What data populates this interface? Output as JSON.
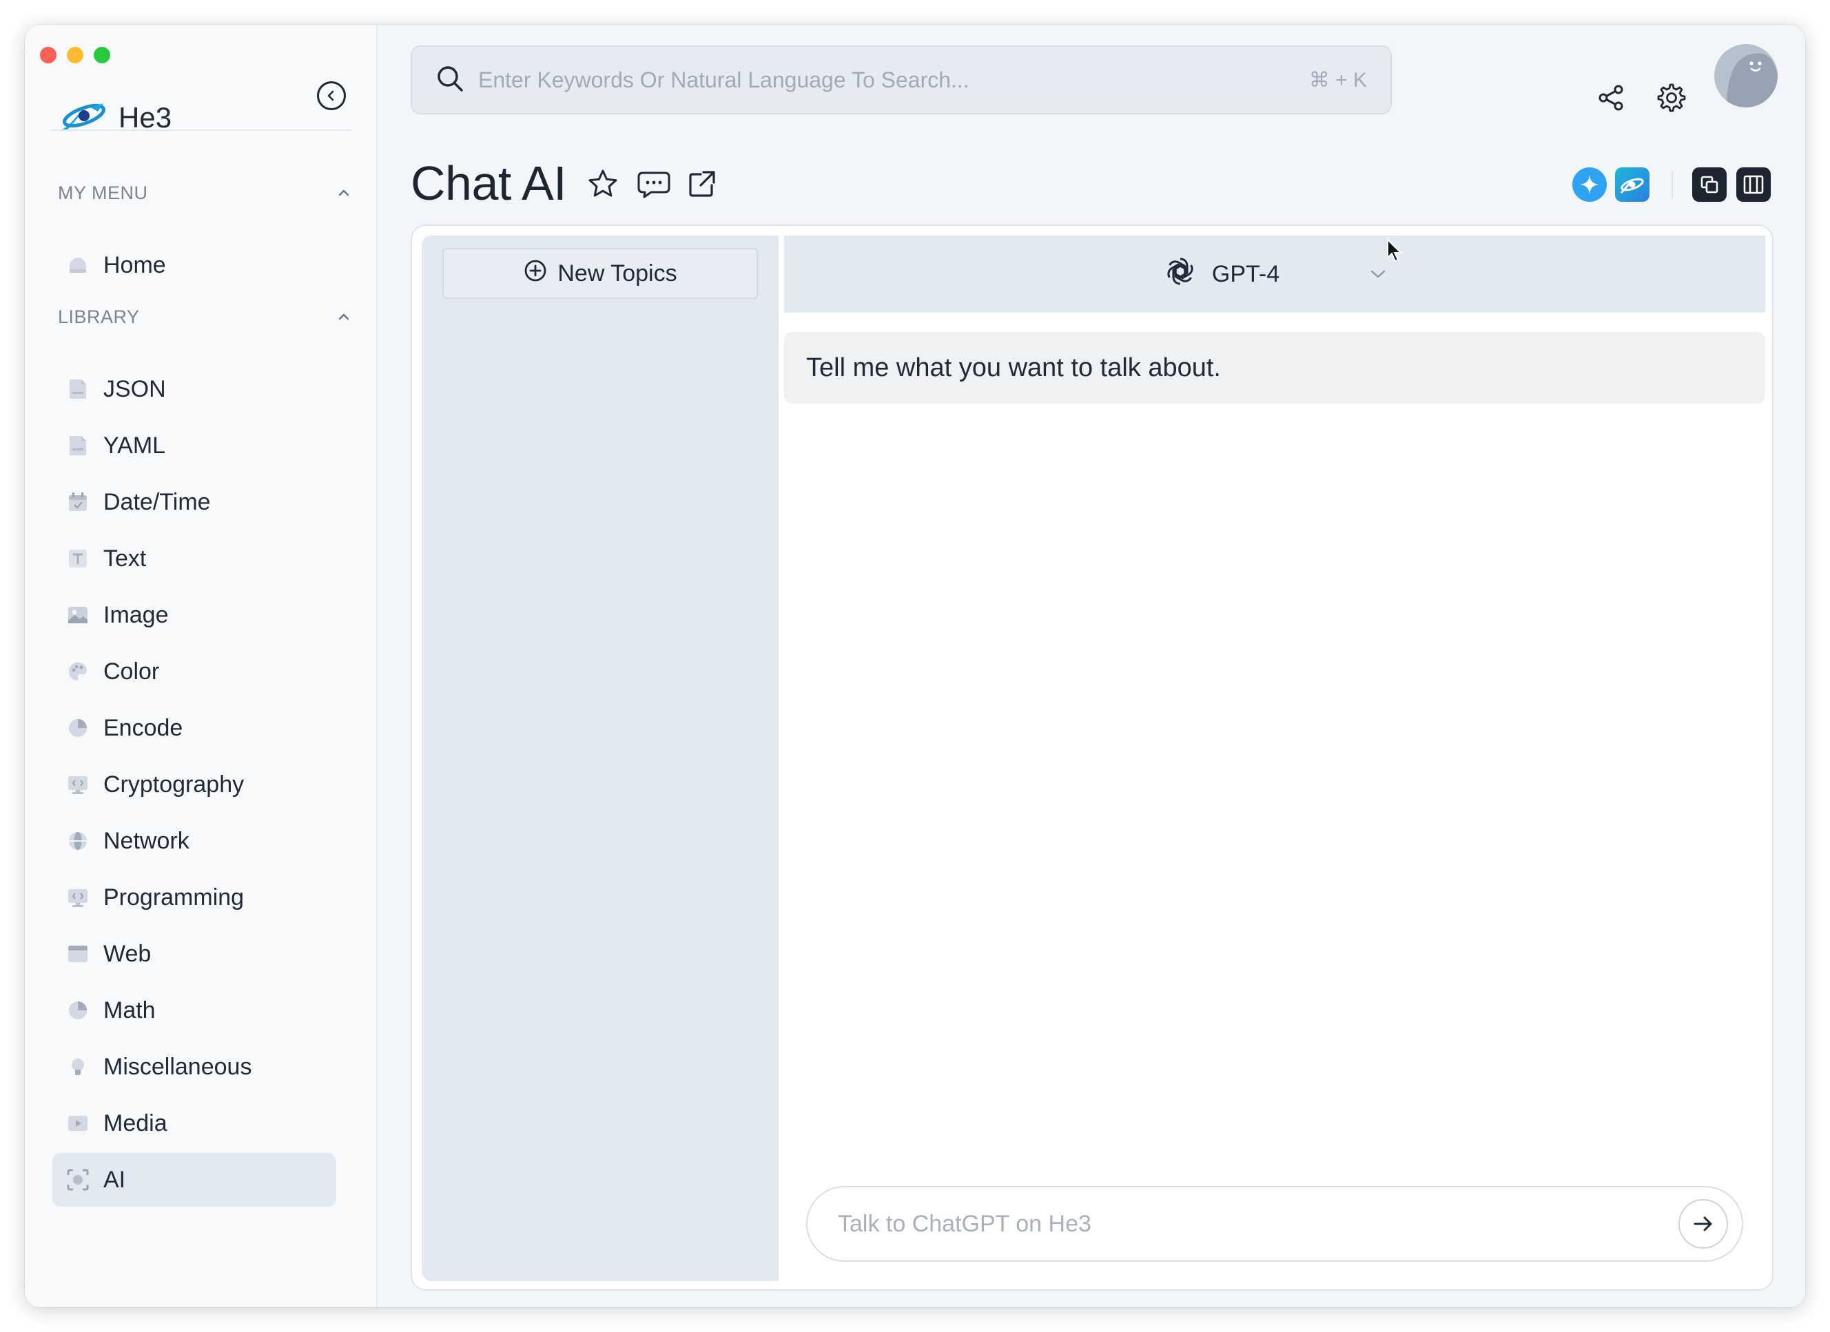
{
  "app": {
    "name": "He3"
  },
  "search": {
    "placeholder": "Enter Keywords Or Natural Language To Search...",
    "shortcut": "⌘ + K"
  },
  "topbar": {
    "icons": [
      "share-icon",
      "settings-icon",
      "avatar"
    ]
  },
  "sidebar": {
    "sections": [
      {
        "label": "MY MENU",
        "items": [
          {
            "label": "Home",
            "icon": "home-icon"
          }
        ]
      },
      {
        "label": "LIBRARY",
        "items": [
          {
            "label": "JSON",
            "icon": "json-file-icon"
          },
          {
            "label": "YAML",
            "icon": "yaml-file-icon"
          },
          {
            "label": "Date/Time",
            "icon": "calendar-icon"
          },
          {
            "label": "Text",
            "icon": "text-icon"
          },
          {
            "label": "Image",
            "icon": "image-icon"
          },
          {
            "label": "Color",
            "icon": "palette-icon"
          },
          {
            "label": "Encode",
            "icon": "pie-icon"
          },
          {
            "label": "Cryptography",
            "icon": "code-monitor-icon"
          },
          {
            "label": "Network",
            "icon": "globe-icon"
          },
          {
            "label": "Programming",
            "icon": "code-monitor-icon"
          },
          {
            "label": "Web",
            "icon": "browser-icon"
          },
          {
            "label": "Math",
            "icon": "pie-icon"
          },
          {
            "label": "Miscellaneous",
            "icon": "bulb-icon"
          },
          {
            "label": "Media",
            "icon": "play-icon"
          },
          {
            "label": "AI",
            "icon": "ai-scan-icon",
            "active": true
          }
        ]
      }
    ]
  },
  "page": {
    "title": "Chat AI"
  },
  "chat": {
    "new_topics_label": "New Topics",
    "model": "GPT-4",
    "messages": [
      {
        "text": "Tell me what you want to talk about."
      }
    ],
    "input_placeholder": "Talk to ChatGPT on He3"
  },
  "colors": {
    "accent": "#1aa4e8",
    "active_bg": "#e3e9f1",
    "panel_bg": "#e3e9f1"
  }
}
